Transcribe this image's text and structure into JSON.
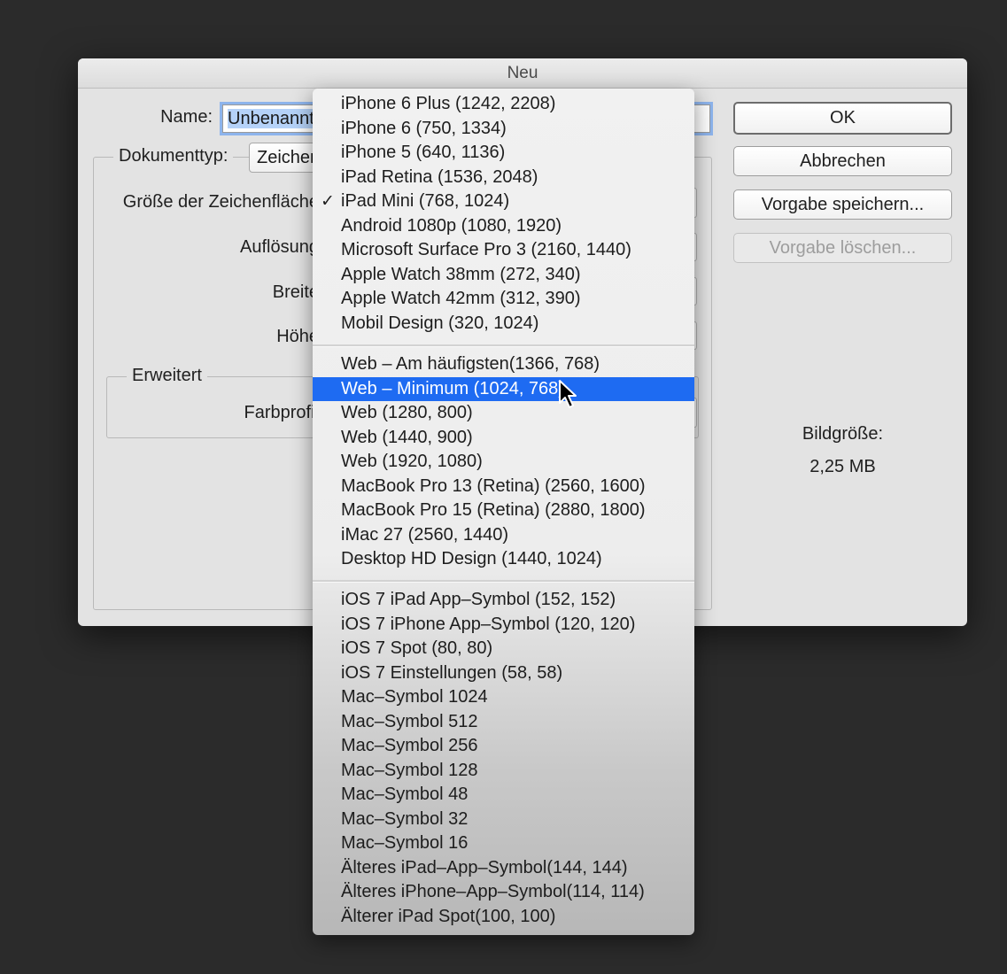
{
  "dialog": {
    "title": "Neu",
    "name_label": "Name:",
    "name_value": "Unbenannt",
    "doctype_label": "Dokumenttyp:",
    "doctype_value": "Zeichenfläche",
    "size_label": "Größe der Zeichenfläche",
    "resolution_label": "Auflösung",
    "width_label": "Breite",
    "height_label": "Höhe",
    "advanced_label": "Erweitert",
    "color_profile_label": "Farbprofil",
    "image_size_label": "Bildgröße:",
    "image_size_value": "2,25 MB"
  },
  "buttons": {
    "ok": "OK",
    "cancel": "Abbrechen",
    "save_preset": "Vorgabe speichern...",
    "delete_preset": "Vorgabe löschen..."
  },
  "menu": {
    "checked_item": "iPad Mini (768, 1024)",
    "highlighted_item": "Web – Minimum (1024, 768)",
    "groups": [
      [
        "iPhone 6 Plus (1242, 2208)",
        "iPhone 6 (750, 1334)",
        "iPhone 5 (640, 1136)",
        "iPad Retina (1536, 2048)",
        "iPad Mini (768, 1024)",
        "Android 1080p (1080, 1920)",
        "Microsoft Surface Pro 3 (2160, 1440)",
        "Apple Watch 38mm (272, 340)",
        "Apple Watch 42mm (312, 390)",
        "Mobil Design (320, 1024)"
      ],
      [
        "Web – Am häufigsten(1366, 768)",
        "Web – Minimum (1024, 768)",
        "Web (1280, 800)",
        "Web (1440, 900)",
        "Web (1920, 1080)",
        "MacBook Pro 13 (Retina) (2560, 1600)",
        "MacBook Pro 15 (Retina) (2880, 1800)",
        "iMac 27 (2560, 1440)",
        "Desktop HD Design (1440, 1024)"
      ],
      [
        "iOS 7 iPad App–Symbol (152, 152)",
        "iOS 7 iPhone App–Symbol (120, 120)",
        "iOS 7 Spot (80, 80)",
        "iOS 7 Einstellungen (58, 58)",
        "Mac–Symbol 1024",
        "Mac–Symbol 512",
        "Mac–Symbol 256",
        "Mac–Symbol 128",
        "Mac–Symbol 48",
        "Mac–Symbol 32",
        "Mac–Symbol 16",
        "Älteres iPad–App–Symbol(144, 144)",
        "Älteres iPhone–App–Symbol(114, 114)",
        "Älterer iPad Spot(100, 100)"
      ]
    ]
  },
  "icons": {
    "checkmark": "checkmark-icon",
    "cursor": "arrow-cursor-icon"
  },
  "colors": {
    "highlight": "#1e6bf2",
    "background": "#2b2b2b",
    "dialog": "#e3e3e3"
  }
}
